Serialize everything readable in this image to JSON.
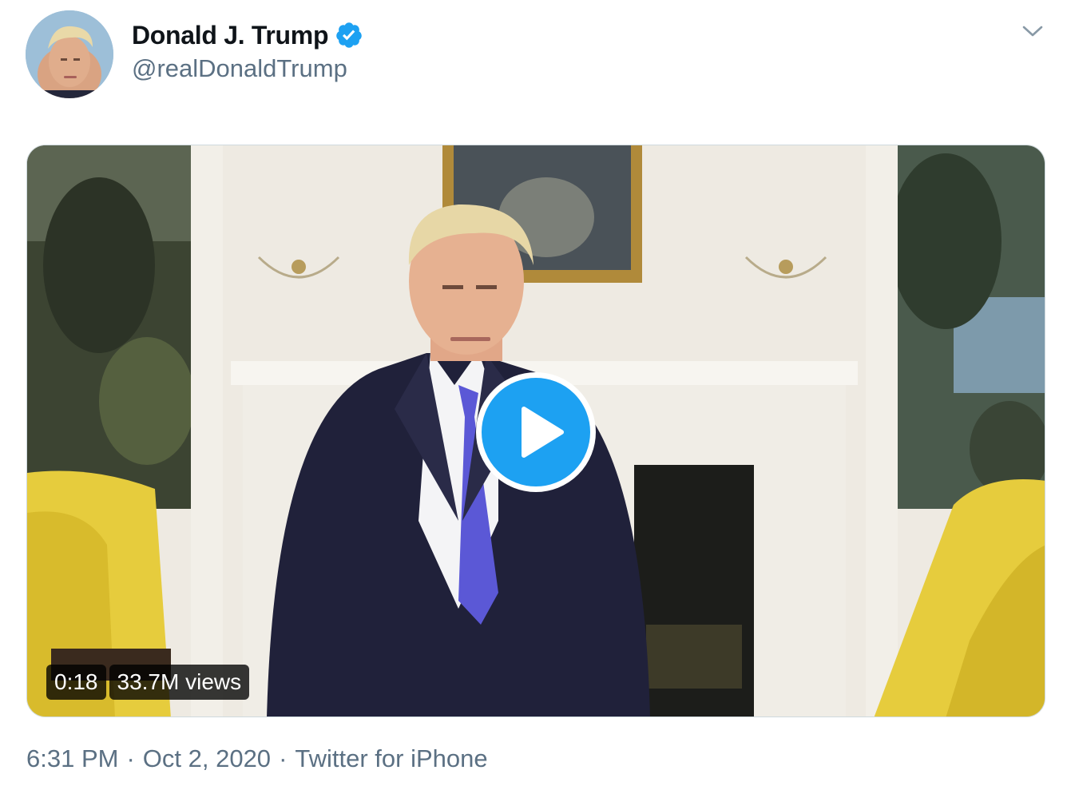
{
  "author": {
    "display_name": "Donald J. Trump",
    "handle": "@realDonaldTrump",
    "verified": true
  },
  "video": {
    "duration": "0:18",
    "views": "33.7M views"
  },
  "meta": {
    "time": "6:31 PM",
    "separator": "·",
    "date": "Oct 2, 2020",
    "source": "Twitter for iPhone"
  },
  "icons": {
    "verified": "verified-badge-icon",
    "more": "chevron-down-icon",
    "play": "play-icon"
  },
  "colors": {
    "accent": "#1da1f2",
    "text_primary": "#0f1419",
    "text_secondary": "#5b7083"
  }
}
